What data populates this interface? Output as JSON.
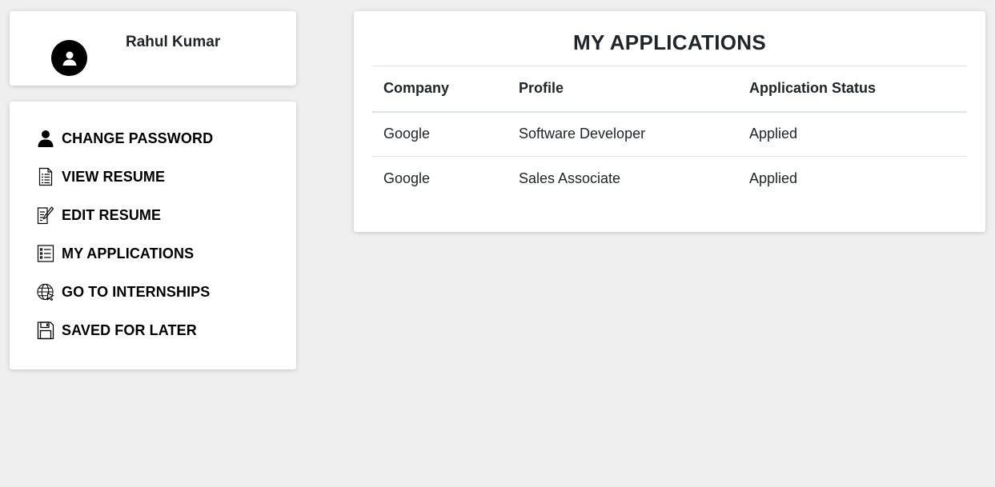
{
  "profile": {
    "name": "Rahul Kumar",
    "avatar_icon": "user-avatar-icon"
  },
  "menu": {
    "items": [
      {
        "label": "CHANGE PASSWORD",
        "icon": "user-icon"
      },
      {
        "label": "VIEW RESUME",
        "icon": "document-icon"
      },
      {
        "label": "EDIT RESUME",
        "icon": "edit-document-icon"
      },
      {
        "label": "MY APPLICATIONS",
        "icon": "list-icon"
      },
      {
        "label": "GO TO INTERNSHIPS",
        "icon": "globe-icon"
      },
      {
        "label": "SAVED FOR LATER",
        "icon": "save-icon"
      }
    ]
  },
  "applications": {
    "title": "MY APPLICATIONS",
    "columns": [
      "Company",
      "Profile",
      "Application Status"
    ],
    "rows": [
      {
        "company": "Google",
        "profile": "Software Developer",
        "status": "Applied"
      },
      {
        "company": "Google",
        "profile": "Sales Associate",
        "status": "Applied"
      }
    ]
  },
  "colors": {
    "background": "#efefef",
    "card": "#ffffff",
    "text": "#212529",
    "divider": "#dee2e6"
  }
}
